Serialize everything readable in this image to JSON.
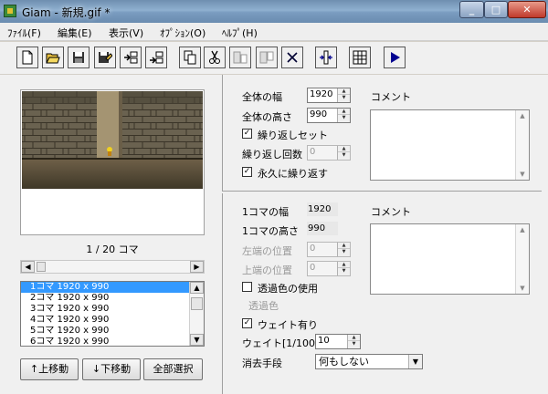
{
  "window": {
    "title": "Giam - 新規.gif *"
  },
  "menu": [
    "ﾌｧｲﾙ(F)",
    "編集(E)",
    "表示(V)",
    "ｵﾌﾟｼｮﾝ(O)",
    "ﾍﾙﾌﾟ(H)"
  ],
  "toolbar_icons": [
    "new-file-icon",
    "open-folder-icon",
    "save-icon",
    "save-as-icon",
    "insert-frame-icon",
    "add-frame-icon",
    "copy-icon",
    "cut-icon",
    "paste-before-icon",
    "paste-after-icon",
    "delete-icon",
    "fit-size-icon",
    "grid-icon",
    "play-icon"
  ],
  "preview": {
    "counter": "1 / 20 コマ"
  },
  "frames": [
    "1コマ 1920 x 990",
    "2コマ 1920 x 990",
    "3コマ 1920 x 990",
    "4コマ 1920 x 990",
    "5コマ 1920 x 990",
    "6コマ 1920 x 990"
  ],
  "buttons": {
    "move_up": "↑上移動",
    "move_down": "↓下移動",
    "select_all": "全部選択"
  },
  "global": {
    "width_label": "全体の幅",
    "width": "1920",
    "height_label": "全体の高さ",
    "height": "990",
    "loop_set_label": "繰り返しセット",
    "loop_count_label": "繰り返し回数",
    "loop_count": "0",
    "loop_forever_label": "永久に繰り返す",
    "comment_label": "コメント"
  },
  "frame": {
    "width_label": "1コマの幅",
    "width": "1920",
    "height_label": "1コマの高さ",
    "height": "990",
    "left_label": "左端の位置",
    "left": "0",
    "top_label": "上端の位置",
    "top": "0",
    "transparent_use_label": "透過色の使用",
    "transparent_color_label": "透過色",
    "wait_label": "ウェイト有り",
    "wait_time_label": "ウェイト[1/100s]",
    "wait_time": "10",
    "dispose_label": "消去手段",
    "dispose_value": "何もしない",
    "comment_label": "コメント"
  }
}
